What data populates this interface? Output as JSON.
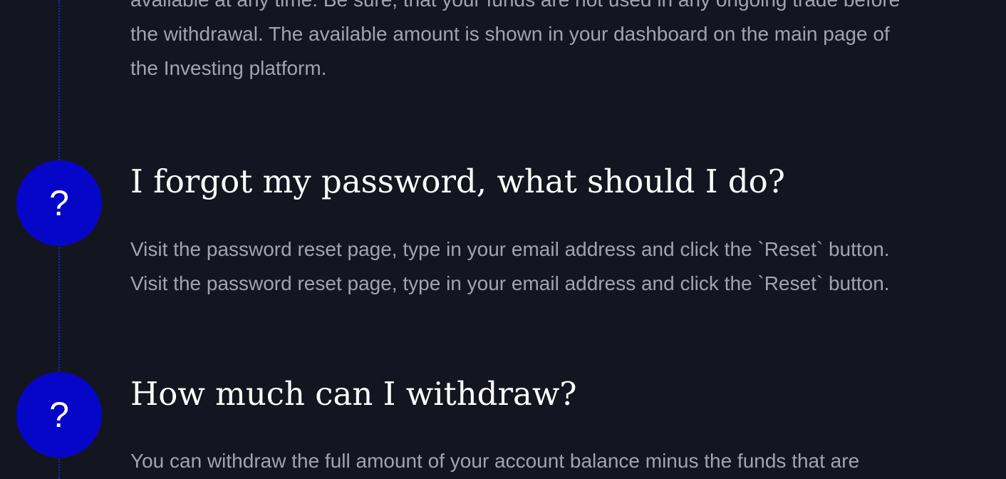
{
  "faq": {
    "item0": {
      "answer_lines": [
        "available at any time. Be sure, that your funds are not used in any ongoing trade before",
        "the withdrawal. The available amount is shown in your dashboard on the main page of",
        "the Investing platform."
      ]
    },
    "item1": {
      "badge": "?",
      "question": "I forgot my password, what should I do?",
      "answer_lines": [
        "Visit the password reset page, type in your email address and click the `Reset` button.",
        "Visit the password reset page, type in your email address and click the `Reset` button."
      ]
    },
    "item2": {
      "badge": "?",
      "question": "How much can I withdraw?",
      "answer_lines": [
        "You can withdraw the full amount of your account balance minus the funds that are"
      ]
    }
  },
  "colors": {
    "background": "#131620",
    "badge": "#0606c8",
    "timeline": "#1a24c8",
    "heading": "#ffffff",
    "body_text": "#a0a4ad"
  },
  "icons": {
    "badge_icon": "question-mark-icon"
  }
}
